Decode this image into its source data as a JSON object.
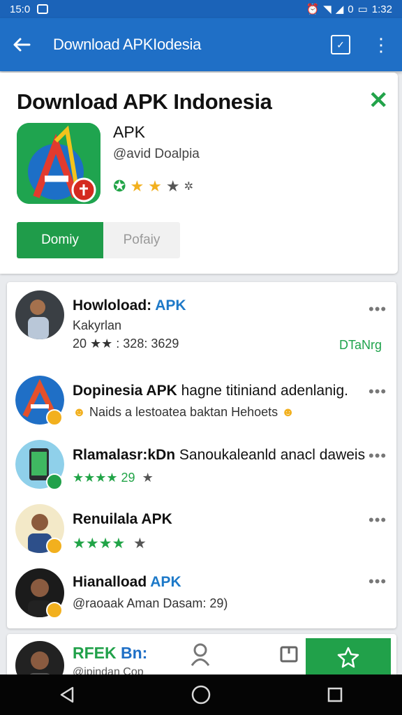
{
  "status_bar": {
    "time": "15:0",
    "battery_pct": "0",
    "clock": "1:32"
  },
  "app_bar": {
    "title": "Download APKIodesia"
  },
  "header": {
    "title": "Download APK Indonesia",
    "app_name": "APK",
    "developer": "@avid Doalpia",
    "rating_stars": 3,
    "tab_active": "Domiy",
    "tab_inactive": "Pofaiy"
  },
  "list": [
    {
      "name_main": "Howloload:",
      "name_hl": "APK",
      "sub1": "Kakyrlan",
      "sub2": "20 ★★ : 328: 3629",
      "tag": "DTaNrg"
    },
    {
      "name_main": "Dopinesia APK",
      "name_normal": "hagne titiniand adenlanig.",
      "sub1": "Naids a lestoatea baktan Hehoets"
    },
    {
      "name_main": "Rlamalasr:kDn",
      "name_normal": "Sanoukaleanld anacl daweis",
      "sub1": "★★★★ 29",
      "extra_star": "★"
    },
    {
      "name_main": "Renuilala APK",
      "sub1": "★★★★",
      "extra_star": "★"
    },
    {
      "name_main": "Hianalload",
      "name_hl": "APK",
      "sub1": "@raoaak Aman Dasam: 29)"
    }
  ],
  "bottom": {
    "label": "RFEK",
    "label_blue": "Bn:",
    "sub": "@ipindan   Cop"
  },
  "colors": {
    "primary": "#1f6fc6",
    "green": "#21a14a",
    "gold": "#f2b01e"
  }
}
